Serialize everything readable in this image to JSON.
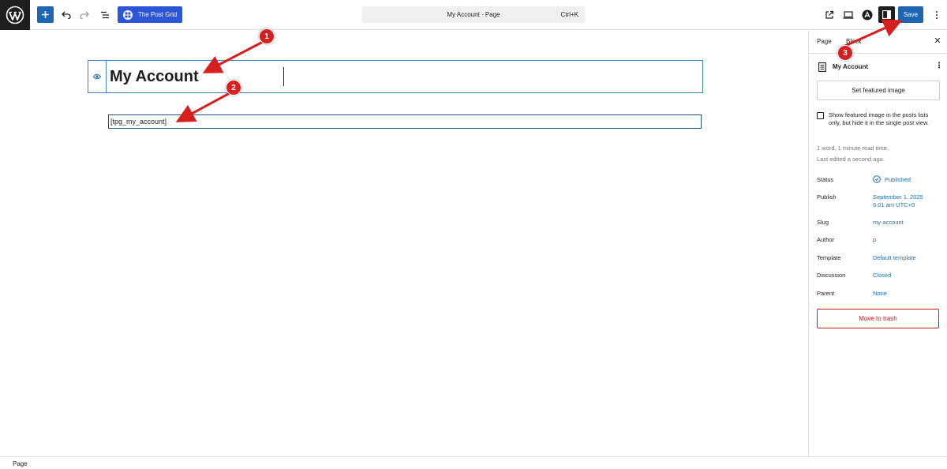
{
  "topbar": {
    "post_grid_label": "The Post Grid",
    "command_bar_title": "My Account · Page",
    "command_bar_shortcut": "Ctrl+K",
    "save_label": "Save"
  },
  "editor": {
    "post_title": "My Account",
    "shortcode": "[tpg_my_account]"
  },
  "sidebar": {
    "tabs": [
      {
        "label": "Page",
        "active": true
      },
      {
        "label": "Block",
        "active": false
      }
    ],
    "document_title": "My Account",
    "featured_image_button": "Set featured image",
    "featured_checkbox_label": "Show featured image in the posts lists only, but hide it in the single post view.",
    "featured_checkbox_checked": false,
    "reading_info": "1 word, 1 minute read time.",
    "last_edited": "Last edited a second ago.",
    "rows": {
      "status": {
        "label": "Status",
        "value": "Published"
      },
      "publish": {
        "label": "Publish",
        "value": "September 1, 2025 6:01 am UTC+0"
      },
      "slug": {
        "label": "Slug",
        "value": "my-account"
      },
      "author": {
        "label": "Author",
        "value": "p"
      },
      "template": {
        "label": "Template",
        "value": "Default template"
      },
      "discussion": {
        "label": "Discussion",
        "value": "Closed"
      },
      "parent": {
        "label": "Parent",
        "value": "None"
      }
    },
    "trash_button": "Move to trash"
  },
  "footer": {
    "breadcrumb": "Page"
  },
  "annotations": {
    "badge_1": "1",
    "badge_2": "2",
    "badge_3": "3",
    "color": "#d62020"
  },
  "colors": {
    "accent": "#1e66b2",
    "post_grid": "#2c55d7",
    "link": "#2271b1",
    "danger": "#cc1818"
  }
}
